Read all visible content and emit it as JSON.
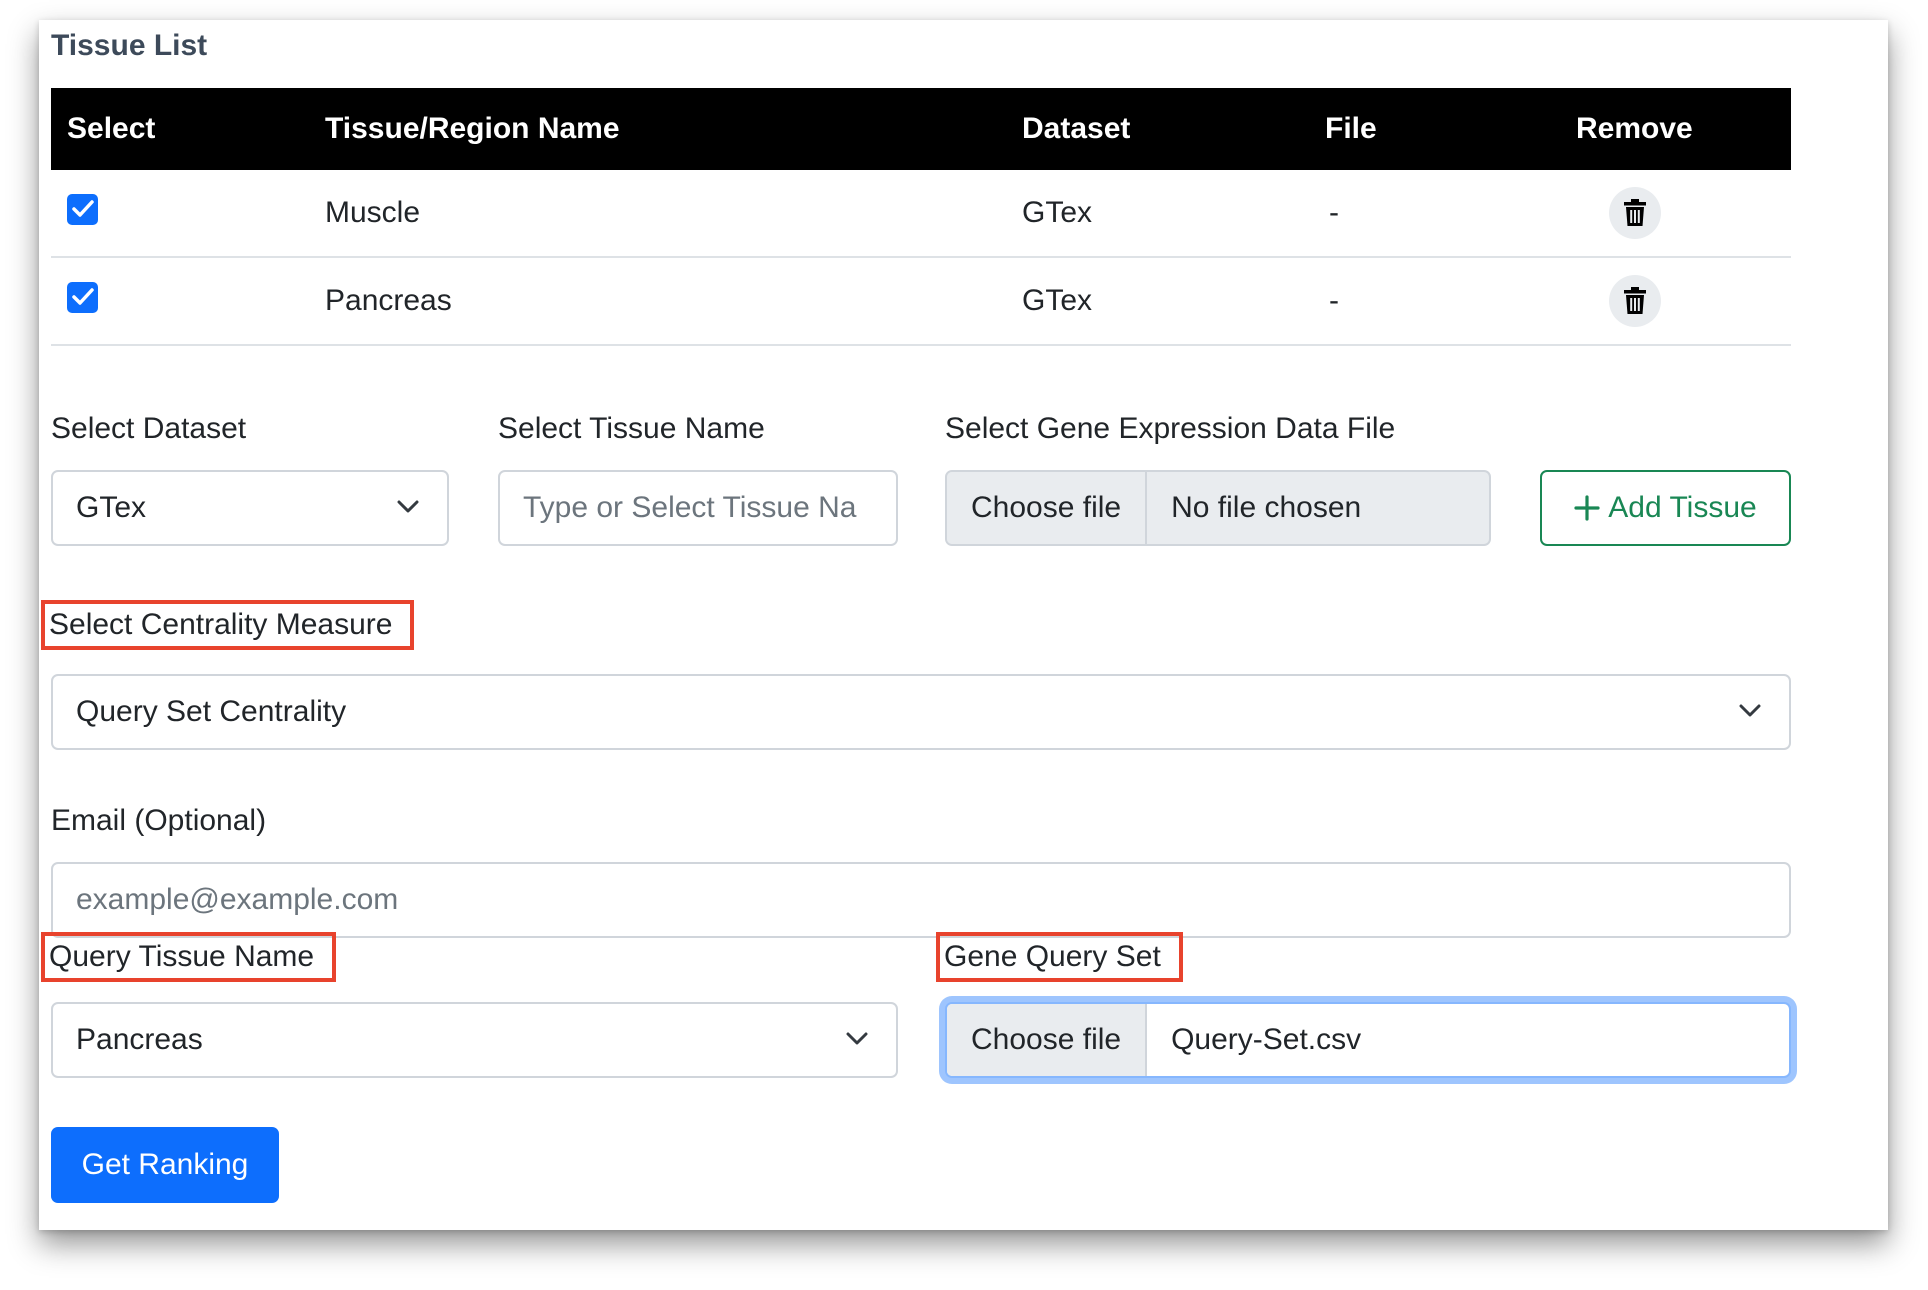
{
  "section_title": "Tissue List",
  "table": {
    "headers": [
      "Select",
      "Tissue/Region Name",
      "Dataset",
      "File",
      "Remove"
    ],
    "rows": [
      {
        "checked": true,
        "name": "Muscle",
        "dataset": "GTex",
        "file": "-"
      },
      {
        "checked": true,
        "name": "Pancreas",
        "dataset": "GTex",
        "file": "-"
      }
    ]
  },
  "add_form": {
    "dataset_label": "Select Dataset",
    "dataset_value": "GTex",
    "tissue_label": "Select Tissue Name",
    "tissue_placeholder": "Type or Select Tissue Na",
    "file_label": "Select Gene Expression Data File",
    "file_button": "Choose file",
    "file_status": "No file chosen",
    "add_button": "Add Tissue",
    "add_icon": "+"
  },
  "centrality": {
    "label": "Select Centrality Measure",
    "value": "Query Set Centrality"
  },
  "email": {
    "label": "Email (Optional)",
    "placeholder": "example@example.com"
  },
  "query_tissue": {
    "label": "Query Tissue Name",
    "value": "Pancreas"
  },
  "gene_query": {
    "label": "Gene Query Set",
    "file_button": "Choose file",
    "file_name": "Query-Set.csv"
  },
  "submit_button": "Get Ranking",
  "colors": {
    "primary": "#0d6efd",
    "success": "#198754",
    "highlight": "#e8432d",
    "header_bg": "#000000",
    "focus_ring": "#9ec5fe"
  },
  "icons": {
    "checkbox": "check-icon",
    "remove": "trash-icon",
    "dropdown": "chevron-down-icon",
    "add": "plus-icon"
  }
}
